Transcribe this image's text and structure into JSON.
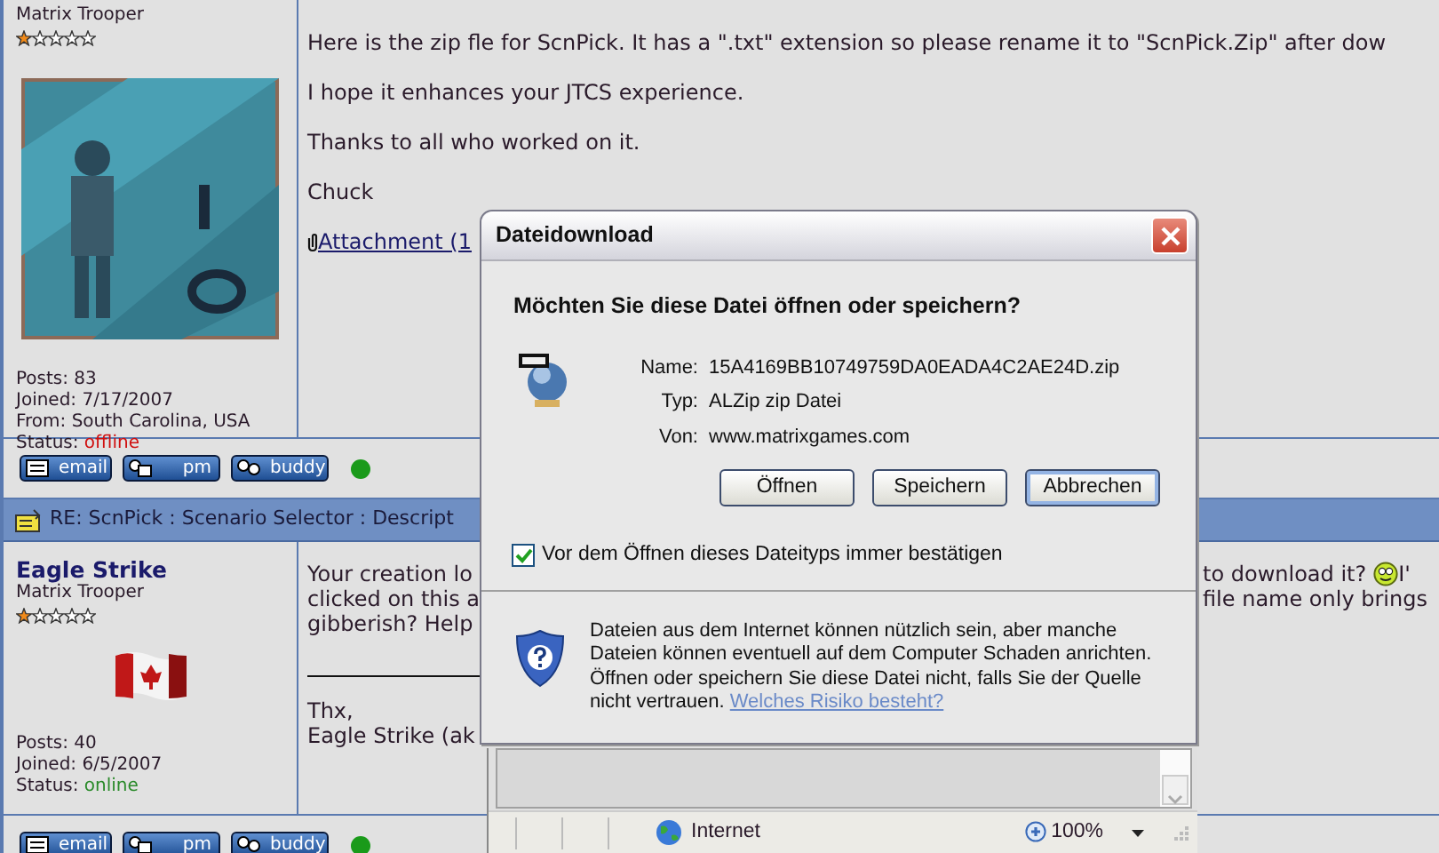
{
  "posts": [
    {
      "rank": "Matrix Trooper",
      "stars": 1,
      "avatar": {
        "kind": "picture"
      },
      "stats": [
        {
          "label": "Posts:",
          "value": "83"
        },
        {
          "label": "Joined:",
          "value": "7/17/2007"
        },
        {
          "label": "From:",
          "value": "South Carolina, USA"
        },
        {
          "label": "Status:",
          "value": "offline",
          "online": false
        }
      ],
      "paragraphs": [
        "Here is the zip fle for ScnPick. It has a \".txt\" extension so please rename it to \"ScnPick.Zip\" after dow",
        "I hope it enhances your JTCS experience.",
        "Thanks to all who worked on it.",
        "Chuck"
      ],
      "attachment": "Attachment (1",
      "buttons": [
        "email",
        "pm",
        "buddy"
      ],
      "presence": true
    },
    {
      "title": "RE: ScnPick : Scenario Selector : Descript",
      "author": "Eagle Strike",
      "rank": "Matrix Trooper",
      "stars": 1,
      "flag": true,
      "stats": [
        {
          "label": "Posts:",
          "value": "40"
        },
        {
          "label": "Joined:",
          "value": "6/5/2007"
        },
        {
          "label": "Status:",
          "value": "online",
          "online": true
        }
      ],
      "lines": [
        {
          "start": "Your creation lo",
          "end": "to download it?",
          "smiley": true,
          "after": "I'"
        },
        {
          "start": "clicked on this a",
          "end": "file name only brings",
          "smiley": false
        },
        {
          "start": "gibberish? Help"
        }
      ],
      "signature": [
        "Thx,",
        "Eagle Strike (ak"
      ],
      "buttons": [
        "email",
        "pm",
        "buddy"
      ],
      "presence": true
    }
  ],
  "dialog": {
    "title": "Dateidownload",
    "question": "Möchten Sie diese Datei öffnen oder speichern?",
    "fields": [
      {
        "label": "Name:",
        "value": "15A4169BB10749759DA0EADA4C2AE24D.zip"
      },
      {
        "label": "Typ:",
        "value": "ALZip zip Datei"
      },
      {
        "label": "Von:",
        "value": "www.matrixgames.com"
      }
    ],
    "buttons": [
      {
        "label": "Öffnen",
        "focused": false
      },
      {
        "label": "Speichern",
        "focused": false
      },
      {
        "label": "Abbrechen",
        "focused": true
      }
    ],
    "confirm": {
      "label": "Vor dem Öffnen dieses Dateityps immer bestätigen",
      "checked": true
    },
    "warning": "Dateien aus dem Internet können nützlich sein, aber manche Dateien können eventuell auf dem Computer Schaden anrichten. Öffnen oder speichern Sie diese Datei nicht, falls Sie der Quelle nicht vertrauen.",
    "warning_link": "Welches Risiko besteht?"
  },
  "browser_status": {
    "zone": "Internet",
    "zoom": "100%"
  }
}
